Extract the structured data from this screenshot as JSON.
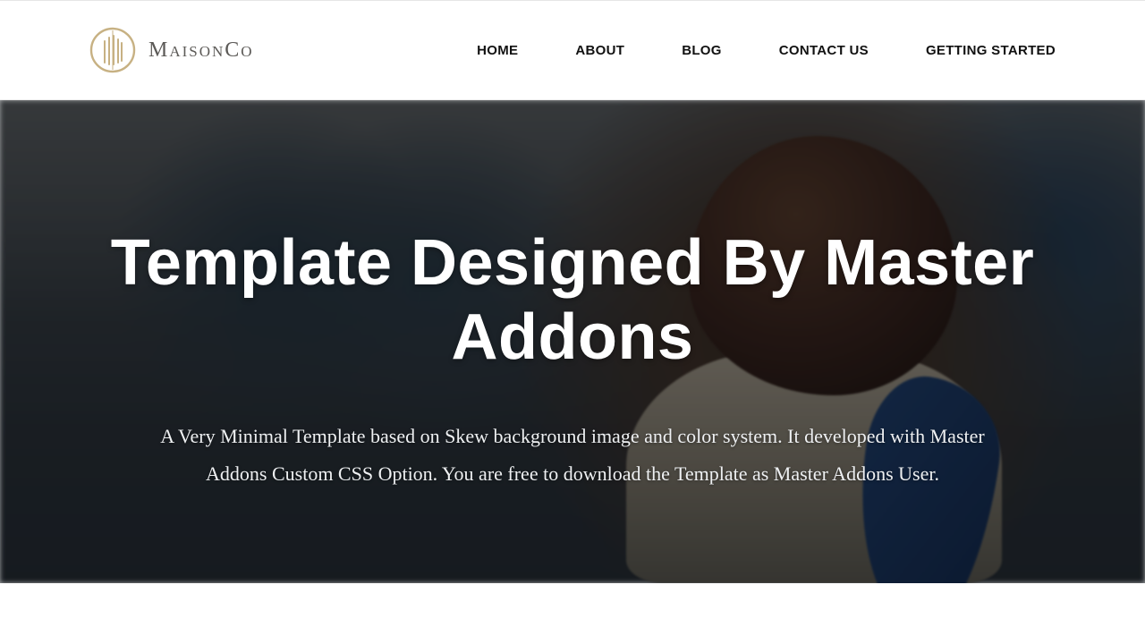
{
  "brand": {
    "name": "MaisonCo"
  },
  "nav": {
    "items": [
      {
        "label": "HOME"
      },
      {
        "label": "ABOUT"
      },
      {
        "label": "BLOG"
      },
      {
        "label": "CONTACT US"
      },
      {
        "label": "GETTING STARTED"
      }
    ]
  },
  "hero": {
    "title": "Template Designed By Master Addons",
    "subtitle": "A Very Minimal Template based on Skew background image and color system. It developed with Master Addons Custom CSS Option. You are free to download the Template as Master Addons User."
  }
}
